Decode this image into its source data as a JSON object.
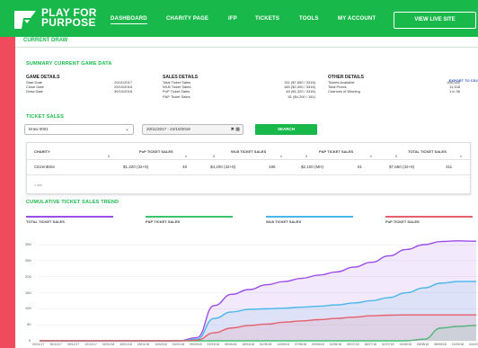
{
  "brand": {
    "line1": "PLAY FOR",
    "line2": "PURPOSE"
  },
  "nav": [
    "DASHBOARD",
    "CHARITY PAGE",
    "IFP",
    "TICKETS",
    "TOOLS",
    "MY ACCOUNT"
  ],
  "live_button": "VIEW LIVE SITE",
  "current_draw": "CURRENT DRAW",
  "export": "EXPORT TO CSV",
  "summary_title": "SUMMARY CURRENT GAME DATA",
  "game_details": {
    "title": "GAME DETAILS",
    "rows": [
      {
        "label": "Start Date",
        "value": "20/11/2017"
      },
      {
        "label": "Close Date",
        "value": "29/10/2018"
      },
      {
        "label": "Draw Date",
        "value": "30/10/2018"
      }
    ]
  },
  "sales_details": {
    "title": "SALES DETAILS",
    "rows": [
      {
        "label": "Total Ticket Sales",
        "value": "311 ($7,650 / 3316)"
      },
      {
        "label": "WLB Ticket Sales",
        "value": "185 ($2,400 / 3316)"
      },
      {
        "label": "PuP Ticket Sales",
        "value": "48 ($1,320 / 3316)"
      },
      {
        "label": "P&P Ticket Sales",
        "value": "81 ($4,200 / 181)"
      }
    ]
  },
  "other_details": {
    "title": "OTHER DETAILS",
    "rows": [
      {
        "label": "Tickets Available",
        "value": "400,000"
      },
      {
        "label": "Total Prizes",
        "value": "11,108"
      },
      {
        "label": "Chances of Winning",
        "value": "1 in 36"
      }
    ]
  },
  "ticket_sales_title": "TICKET SALES",
  "filter": {
    "draw": "Draw 0001",
    "dates": "20/11/2017 - 22/10/2018",
    "search": "SEARCH"
  },
  "table": {
    "headers": [
      "CHARITY",
      "PuP TICKET SALES",
      "WLB TICKET SALES",
      "P&P TICKET SALES",
      "TOTAL TICKET SALES"
    ],
    "sub": [
      "$",
      "#",
      "$",
      "#",
      "$",
      "#",
      "$",
      "#"
    ],
    "row": {
      "charity": "CitizenBrite",
      "pup_amt": "$1,320 (32+8)",
      "pup_n": "48",
      "wlb_amt": "$4,200 (32+8)",
      "wlb_n": "185",
      "pp_amt": "$2,100 (MH)",
      "pp_n": "81",
      "total_amt": "$7,650 (32+8)",
      "total_n": "311"
    },
    "footer": "1 row"
  },
  "trend_title": "CUMULATIVE TICKET SALES TREND",
  "chart_data": {
    "type": "area",
    "x": [
      "20/11/17",
      "30/11/17",
      "09/12/17",
      "22/12/17",
      "02/01/18",
      "15/01/18",
      "28/01/18",
      "10/02/18",
      "24/02/18",
      "09/03/18",
      "22/03/18",
      "05/04/18",
      "18/04/18",
      "01/05/18",
      "14/05/18",
      "27/05/18",
      "09/06/18",
      "22/06/18",
      "05/07/18",
      "18/07/18",
      "31/07/18",
      "13/08/18",
      "26/08/18",
      "08/09/18",
      "21/09/18",
      "04/10/18"
    ],
    "series": [
      {
        "name": "TOTAL TICKET SALES",
        "color": "#9b4de8",
        "values": [
          0,
          0,
          0,
          0,
          0,
          0,
          0,
          0,
          0,
          10,
          110,
          145,
          160,
          175,
          185,
          195,
          205,
          215,
          230,
          245,
          265,
          285,
          300,
          310,
          312,
          311
        ]
      },
      {
        "name": "P&P TICKET SALES",
        "color": "#39c46a",
        "values": [
          0,
          0,
          0,
          0,
          0,
          0,
          0,
          0,
          0,
          0,
          0,
          0,
          0,
          0,
          0,
          0,
          0,
          0,
          0,
          0,
          0,
          0,
          5,
          40,
          45,
          48
        ]
      },
      {
        "name": "WLB TICKET SALES",
        "color": "#46b7ea",
        "values": [
          0,
          0,
          0,
          0,
          0,
          0,
          0,
          0,
          0,
          5,
          70,
          90,
          98,
          100,
          102,
          105,
          108,
          112,
          118,
          125,
          135,
          150,
          165,
          180,
          185,
          185
        ]
      },
      {
        "name": "PuP TICKET SALES",
        "color": "#e4606c",
        "values": [
          0,
          0,
          0,
          0,
          0,
          0,
          0,
          0,
          0,
          2,
          25,
          40,
          48,
          52,
          58,
          62,
          66,
          70,
          74,
          78,
          80,
          81,
          81,
          81,
          81,
          81
        ]
      }
    ],
    "y_ticks": [
      0,
      50,
      100,
      150,
      200,
      250,
      300
    ],
    "ylim": [
      0,
      320
    ],
    "grid": true
  },
  "colors": {
    "brand_green": "#18b94a",
    "side_red": "#ef4b5c",
    "link_blue": "#3557c8"
  }
}
